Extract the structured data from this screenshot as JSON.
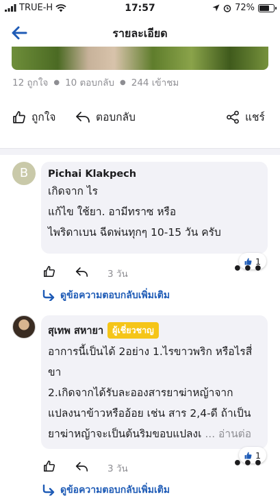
{
  "status_bar": {
    "carrier": "TRUE-H",
    "time": "17:57",
    "battery": "72%",
    "battery_level": 0.72
  },
  "nav": {
    "title": "รายละเอียด"
  },
  "post_stats": {
    "likes": "12 ถูกใจ",
    "replies": "10 ตอบกลับ",
    "views": "244 เข้าชม"
  },
  "post_actions": {
    "like_label": "ถูกใจ",
    "reply_label": "ตอบกลับ",
    "share_label": "แชร์"
  },
  "comments": [
    {
      "avatar_letter": "B",
      "author": "Pichai Klakpech",
      "badge": "",
      "text": "เกิดจาก ไร\nแก้ไข ใช้ยา. อามีทราซ หรือ\nไพริดาเบน ฉีดพ่นทุกๆ 10-15 วัน ครับ",
      "read_more": "",
      "like_count": "1",
      "time": "3 วัน",
      "view_more_replies": "ดูข้อความตอบกลับเพิ่มเติม"
    },
    {
      "avatar_letter": "",
      "author": "สุเทพ สหายา",
      "badge": "ผู้เชี่ยวชาญ",
      "text": "อาการนี้เป็นได้ 2อย่าง 1.ไรขาวพริก หรือไรสี่\nขา\n2.เกิดจากได้รับละอองสารยาฆ่าหญ้าจาก\nแปลงนาข้าวหรืออ้อย เช่น สาร 2,4-ดี ถ้าเป็น\nยาฆ่าหญ้าจะเป็นต้นริมขอบแปลงเ",
      "read_more": "... อ่านต่อ",
      "like_count": "1",
      "time": "3 วัน",
      "view_more_replies": "ดูข้อความตอบกลับเพิ่มเติม"
    }
  ],
  "colors": {
    "accent": "#1e5bb6",
    "badge": "#f5c518",
    "bubble": "#f2f2f7",
    "muted": "#8e8e93"
  }
}
